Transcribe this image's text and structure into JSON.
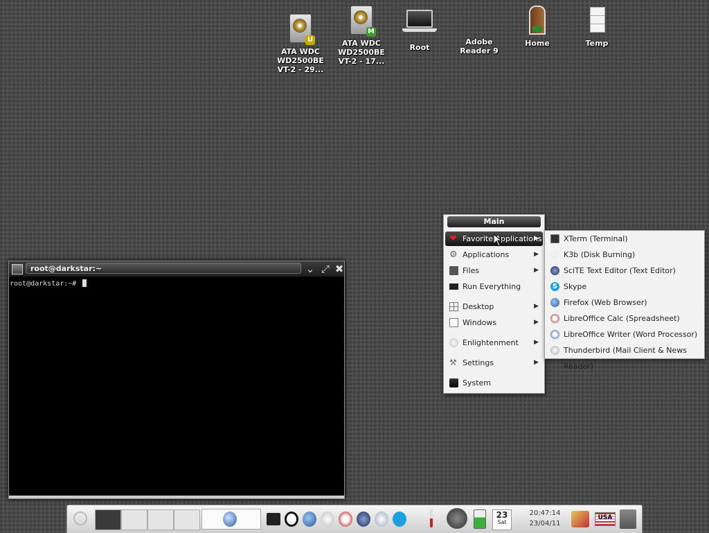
{
  "desktop_icons": [
    {
      "id": "hdd1",
      "label": "ATA WDC WD2500BE VT-2 - 29...",
      "icon": "hard-drive-icon",
      "badge": "U",
      "badge_color": "#c8a800"
    },
    {
      "id": "hdd2",
      "label": "ATA WDC WD2500BE VT-2 - 17...",
      "icon": "hard-drive-icon",
      "badge": "M",
      "badge_color": "#3a9a2a"
    },
    {
      "id": "root",
      "label": "Root",
      "icon": "laptop-icon"
    },
    {
      "id": "adobe",
      "label": "Adobe Reader 9",
      "icon": "adobe-reader-icon"
    },
    {
      "id": "home",
      "label": "Home",
      "icon": "home-door-icon"
    },
    {
      "id": "temp",
      "label": "Temp",
      "icon": "boxes-icon"
    }
  ],
  "terminal": {
    "title": "root@darkstar:~",
    "prompt": "root@darkstar:~# "
  },
  "main_menu": {
    "header": "Main",
    "items": [
      {
        "label": "Favorite Applications",
        "icon": "heart-icon",
        "submenu": true,
        "active": true
      },
      {
        "label": "Applications",
        "icon": "gear-icon",
        "submenu": true
      },
      {
        "label": "Files",
        "icon": "folder-icon",
        "submenu": true
      },
      {
        "label": "Run Everything",
        "icon": "terminal-icon",
        "submenu": false
      },
      {
        "label": "Desktop",
        "icon": "desktop-grid-icon",
        "submenu": true
      },
      {
        "label": "Windows",
        "icon": "window-icon",
        "submenu": true
      },
      {
        "label": "Enlightenment",
        "icon": "enlightenment-icon",
        "submenu": true
      },
      {
        "label": "Settings",
        "icon": "wrench-icon",
        "submenu": true
      },
      {
        "label": "System",
        "icon": "computer-icon",
        "submenu": false
      }
    ]
  },
  "favorites_menu": {
    "items": [
      {
        "label": "XTerm (Terminal)",
        "icon": "xterm-icon",
        "color": "#333333"
      },
      {
        "label": "K3b (Disk Burning)",
        "icon": "k3b-icon",
        "color": "#eeeeee"
      },
      {
        "label": "SciTE Text Editor (Text Editor)",
        "icon": "scite-icon",
        "color": "#2b3a6b"
      },
      {
        "label": "Skype",
        "icon": "skype-icon",
        "color": "#1ea0e0"
      },
      {
        "label": "Firefox (Web Browser)",
        "icon": "firefox-icon",
        "color": "#3a6fb0"
      },
      {
        "label": "LibreOffice Calc (Spreadsheet)",
        "icon": "libreoffice-calc-icon",
        "color": "#c04040"
      },
      {
        "label": "LibreOffice Writer (Word Processor)",
        "icon": "libreoffice-writer-icon",
        "color": "#4070c0"
      },
      {
        "label": "Thunderbird (Mail Client & News Reader)",
        "icon": "thunderbird-icon",
        "color": "#dddddd"
      }
    ]
  },
  "shelf": {
    "calendar_day": "23",
    "calendar_weekday": "Sat",
    "clock_time": "20:47:14",
    "clock_date": "23/04/11",
    "keyboard_layout": "USA"
  }
}
